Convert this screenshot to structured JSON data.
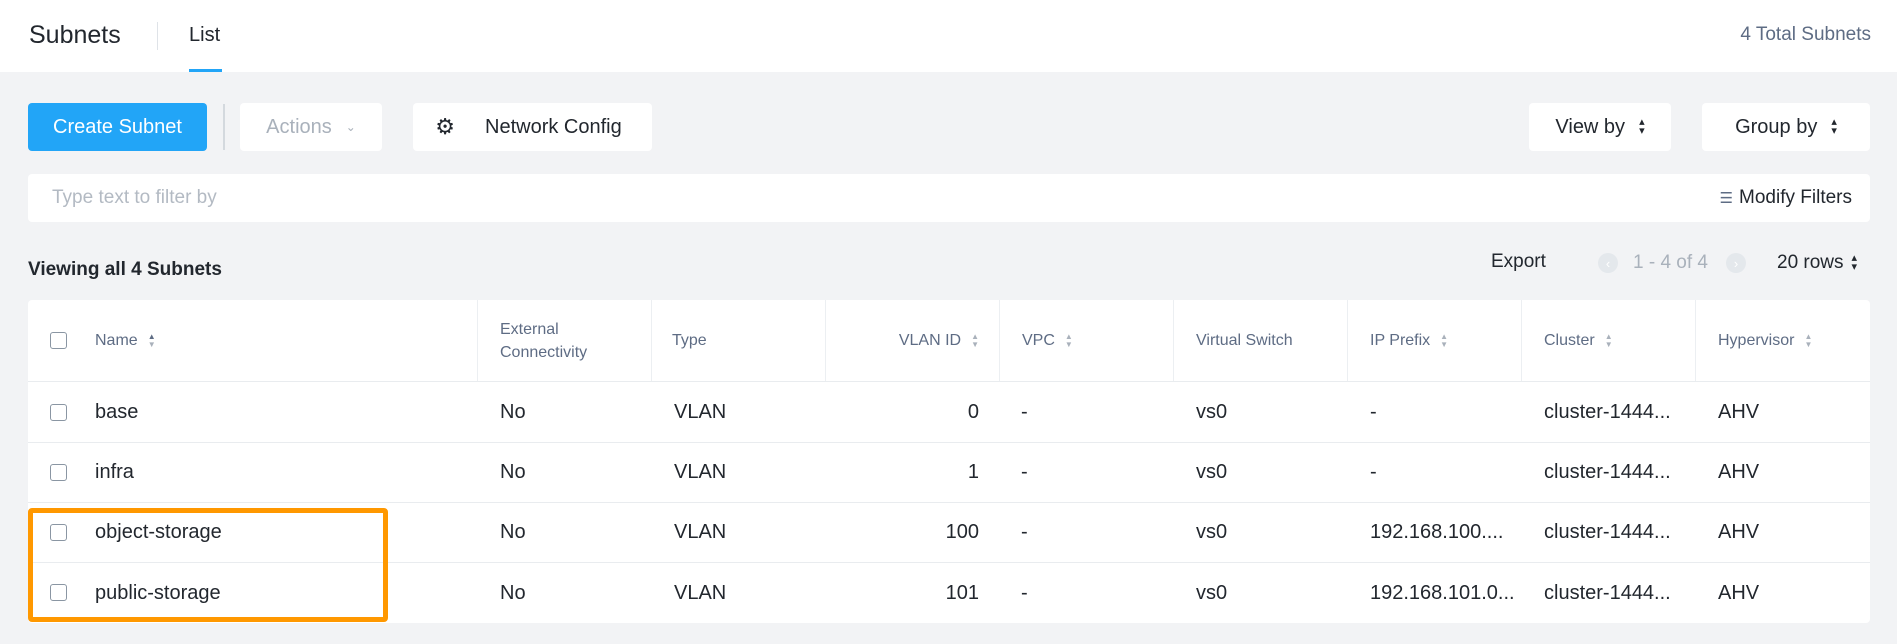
{
  "header": {
    "title": "Subnets",
    "tabs": [
      {
        "label": "List",
        "active": true
      }
    ],
    "total_count": "4 Total Subnets"
  },
  "toolbar": {
    "create_label": "Create Subnet",
    "actions_label": "Actions",
    "network_config_label": "Network Config",
    "view_by_label": "View by",
    "group_by_label": "Group by"
  },
  "filter": {
    "placeholder": "Type text to filter by",
    "value": "",
    "modify_label": "Modify Filters"
  },
  "table_meta": {
    "viewing_label": "Viewing all 4 Subnets",
    "export_label": "Export",
    "page_range": "1 - 4 of 4",
    "rows_per_page": "20 rows"
  },
  "table": {
    "columns": [
      {
        "key": "name",
        "label": "Name",
        "sortable": true,
        "sorted": "asc"
      },
      {
        "key": "external",
        "label": "External Connectivity",
        "sortable": false
      },
      {
        "key": "type",
        "label": "Type",
        "sortable": false
      },
      {
        "key": "vlan",
        "label": "VLAN ID",
        "sortable": true
      },
      {
        "key": "vpc",
        "label": "VPC",
        "sortable": true
      },
      {
        "key": "vswitch",
        "label": "Virtual Switch",
        "sortable": false
      },
      {
        "key": "ip_prefix",
        "label": "IP Prefix",
        "sortable": true
      },
      {
        "key": "cluster",
        "label": "Cluster",
        "sortable": true
      },
      {
        "key": "hypervisor",
        "label": "Hypervisor",
        "sortable": true
      }
    ],
    "rows": [
      {
        "name": "base",
        "external": "No",
        "type": "VLAN",
        "vlan": "0",
        "vpc": "-",
        "vswitch": "vs0",
        "ip_prefix": "-",
        "cluster": "cluster-1444...",
        "hypervisor": "AHV"
      },
      {
        "name": "infra",
        "external": "No",
        "type": "VLAN",
        "vlan": "1",
        "vpc": "-",
        "vswitch": "vs0",
        "ip_prefix": "-",
        "cluster": "cluster-1444...",
        "hypervisor": "AHV"
      },
      {
        "name": "object-storage",
        "external": "No",
        "type": "VLAN",
        "vlan": "100",
        "vpc": "-",
        "vswitch": "vs0",
        "ip_prefix": "192.168.100....",
        "cluster": "cluster-1444...",
        "hypervisor": "AHV"
      },
      {
        "name": "public-storage",
        "external": "No",
        "type": "VLAN",
        "vlan": "101",
        "vpc": "-",
        "vswitch": "vs0",
        "ip_prefix": "192.168.101.0...",
        "cluster": "cluster-1444...",
        "hypervisor": "AHV"
      }
    ]
  },
  "colors": {
    "accent": "#22a5f7",
    "highlight": "#ff9800",
    "background": "#f2f3f5"
  },
  "icons": {
    "network_config": "gear-icon",
    "actions_dropdown": "chevron-down-icon",
    "filter": "filter-icon",
    "sort": "sort-icon"
  }
}
